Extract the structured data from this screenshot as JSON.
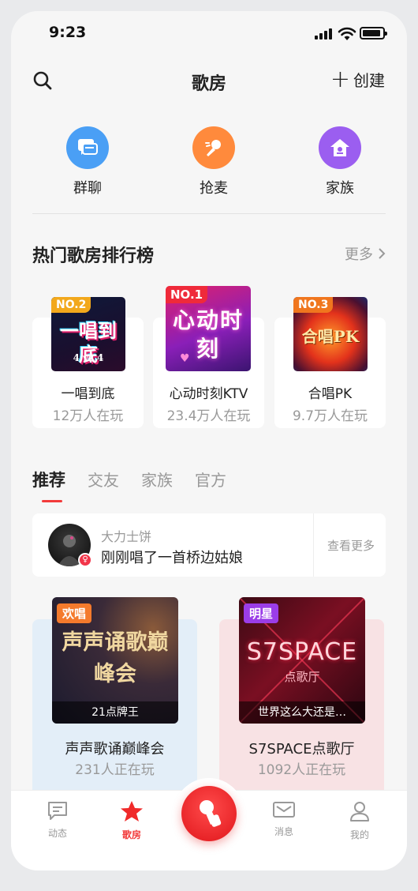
{
  "status_bar": {
    "time": "9:23"
  },
  "header": {
    "title": "歌房",
    "create_label": "创建"
  },
  "quick_actions": [
    {
      "label": "群聊",
      "color": "#4a9ff5",
      "icon": "chat-icon"
    },
    {
      "label": "抢麦",
      "color": "#ff8a3c",
      "icon": "mic-icon"
    },
    {
      "label": "家族",
      "color": "#9b5ef0",
      "icon": "home-icon"
    }
  ],
  "ranking": {
    "title": "热门歌房排行榜",
    "more_label": "更多",
    "items": [
      {
        "rank": "NO.2",
        "cover_text": "一唱到底",
        "cover_sub": "4 vs 4",
        "name": "一唱到底",
        "count": "12万人在玩"
      },
      {
        "rank": "NO.1",
        "cover_text": "心动时刻",
        "name": "心动时刻KTV",
        "count": "23.4万人在玩"
      },
      {
        "rank": "NO.3",
        "cover_text": "合唱PK",
        "name": "合唱PK",
        "count": "9.7万人在玩"
      }
    ]
  },
  "tabs": [
    {
      "label": "推荐",
      "active": true
    },
    {
      "label": "交友",
      "active": false
    },
    {
      "label": "家族",
      "active": false
    },
    {
      "label": "官方",
      "active": false
    }
  ],
  "activity": {
    "user": "大力士饼",
    "text": "刚刚唱了一首桥边姑娘",
    "more_label": "查看更多",
    "gender_symbol": "♀"
  },
  "rooms": [
    {
      "tag": "欢唱",
      "tag_color": "#f47a2c",
      "cover_text": "声声诵歌巅峰会",
      "caption": "21点牌王",
      "name": "声声歌诵巅峰会",
      "count": "231人正在玩",
      "bg": "#e3eef8"
    },
    {
      "tag": "明星",
      "tag_color": "#9b3de8",
      "cover_text": "S7SPACE",
      "cover_sub": "点歌厅",
      "caption": "世界这么大还是…",
      "name": "S7SPACE点歌厅",
      "count": "1092人正在玩",
      "bg": "#f8e2e4"
    }
  ],
  "bottom_nav": [
    {
      "label": "动态",
      "active": false
    },
    {
      "label": "歌房",
      "active": true
    },
    {
      "label": "消息",
      "active": false
    },
    {
      "label": "我的",
      "active": false
    }
  ]
}
